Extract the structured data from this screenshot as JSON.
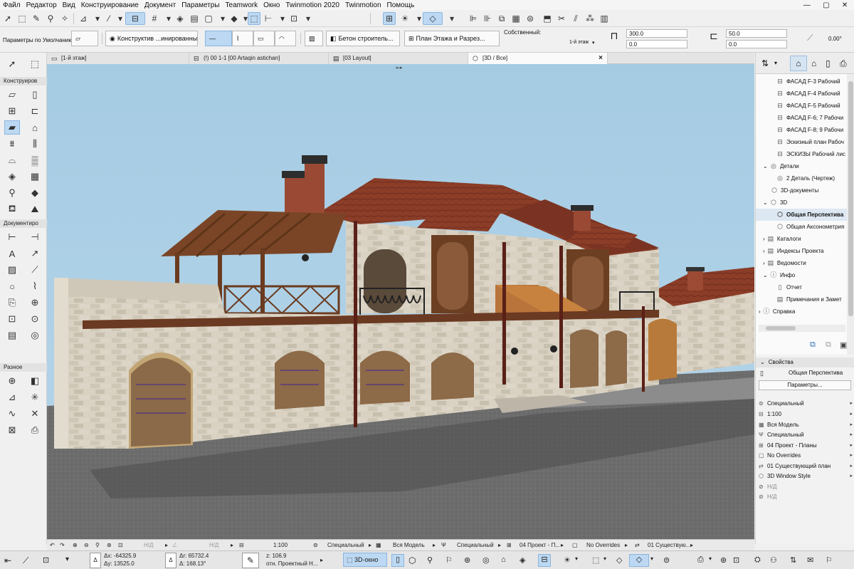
{
  "menu": [
    "Файл",
    "Редактор",
    "Вид",
    "Конструирование",
    "Документ",
    "Параметры",
    "Teamwork",
    "Окно",
    "Twinmotion 2020",
    "Twinmotion",
    "Помощь"
  ],
  "infobar": {
    "default_params": "Параметры по Умолчанию",
    "structure": "Конструктив ...инированный",
    "material": "Бетон строитель...",
    "floor_plan": "План Этажа и Разрез...",
    "own_label": "Собственный:",
    "floor_label": "1-й этаж",
    "value_1": "300.0",
    "value_2": "0.0",
    "value_3": "50.0",
    "value_4": "0.0",
    "angle": "0.00°"
  },
  "toolbox": {
    "sections": [
      "Конструиров",
      "Документиро",
      "Разное"
    ]
  },
  "tabs": [
    {
      "label": "[1-й этаж]",
      "icon": "floor-plan-icon"
    },
    {
      "label": "(!) 00 1-1 [00 Artaqin astichan]",
      "icon": "section-icon"
    },
    {
      "label": "[03 Layout]",
      "icon": "layout-icon"
    },
    {
      "label": "[3D / Все]",
      "icon": "3d-icon",
      "close": "×"
    }
  ],
  "navigator": {
    "items": [
      {
        "label": "ФАСАД  F-3 Рабочий",
        "icon": "facade-icon",
        "indent": 2
      },
      {
        "label": "ФАСАД  F-4 Рабочий",
        "icon": "facade-icon",
        "indent": 2
      },
      {
        "label": "ФАСАД  F-5 Рабочий",
        "icon": "facade-icon",
        "indent": 2
      },
      {
        "label": "ФАСАД  F-6; 7 Рабочи",
        "icon": "facade-icon",
        "indent": 2
      },
      {
        "label": "ФАСАД  F-8; 9 Рабочи",
        "icon": "facade-icon",
        "indent": 2
      },
      {
        "label": "Эскизный план Рабоч",
        "icon": "facade-icon",
        "indent": 2
      },
      {
        "label": "ЭСКИЗЫ Рабочий лис",
        "icon": "facade-icon",
        "indent": 2
      },
      {
        "label": "Детали",
        "icon": "detail-icon",
        "indent": 1,
        "toggle": "⌄"
      },
      {
        "label": "2 Деталь (Чертеж)",
        "icon": "detail-icon",
        "indent": 2
      },
      {
        "label": "3D-документы",
        "icon": "3d-doc-icon",
        "indent": 1
      },
      {
        "label": "3D",
        "icon": "3d-icon",
        "indent": 1,
        "toggle": "⌄"
      },
      {
        "label": "Общая Перспектива",
        "icon": "perspective-icon",
        "indent": 2,
        "selected": true
      },
      {
        "label": "Общая Аксонометрия",
        "icon": "axonometry-icon",
        "indent": 2
      },
      {
        "label": "Каталоги",
        "icon": "catalog-icon",
        "indent": 1,
        "toggle": "›"
      },
      {
        "label": "Индексы Проекта",
        "icon": "index-icon",
        "indent": 1,
        "toggle": "›"
      },
      {
        "label": "Ведомости",
        "icon": "schedule-icon",
        "indent": 1,
        "toggle": "›"
      },
      {
        "label": "Инфо",
        "icon": "info-icon",
        "indent": 1,
        "toggle": "⌄"
      },
      {
        "label": "Отчет",
        "icon": "report-icon",
        "indent": 2
      },
      {
        "label": "Примечания и Замет",
        "icon": "notes-icon",
        "indent": 2
      },
      {
        "label": "Справка",
        "icon": "help-icon",
        "indent": 0,
        "toggle": "›"
      }
    ]
  },
  "properties": {
    "title": "Свойства",
    "view_name": "Общая Перспектива",
    "params_button": "Параметры...",
    "rows": [
      {
        "label": "Специальный",
        "icon": "layer-icon"
      },
      {
        "label": "1:100",
        "icon": "scale-icon"
      },
      {
        "label": "Вся Модель",
        "icon": "model-icon"
      },
      {
        "label": "Специальный",
        "icon": "pen-icon"
      },
      {
        "label": "04 Проект - Планы",
        "icon": "mvo-icon"
      },
      {
        "label": "No Overrides",
        "icon": "override-icon"
      },
      {
        "label": "01 Существующий план",
        "icon": "renovation-icon"
      },
      {
        "label": "3D Window Style",
        "icon": "3d-style-icon"
      },
      {
        "label": "Н/Д",
        "icon": "na-icon"
      },
      {
        "label": "Н/Д",
        "icon": "na-icon"
      }
    ]
  },
  "quickbar": {
    "nd1": "Н/Д",
    "nd2": "Н/Д",
    "scale": "1:100",
    "layer": "Специальный",
    "model": "Вся Модель",
    "pen": "Специальный",
    "mvo": "04 Проект - П...",
    "override": "No Overrides",
    "renovation": "01 Существую..."
  },
  "status": {
    "dx": "Δx: -64325.9",
    "dy": "Δy: 13525.0",
    "dr": "Δr: 65732.4",
    "da": "Δ: 168.13°",
    "z": "z: 106.9",
    "ref": "отн. Проектный Н...",
    "view3d": "3D-окно"
  },
  "colors": {
    "sky": "#a7cce4",
    "accent": "#bcd8f2",
    "roof": "#8a3e2a",
    "stone": "#d8d2c4",
    "wood": "#6d3f22",
    "asphalt": "#6e6e6e"
  }
}
